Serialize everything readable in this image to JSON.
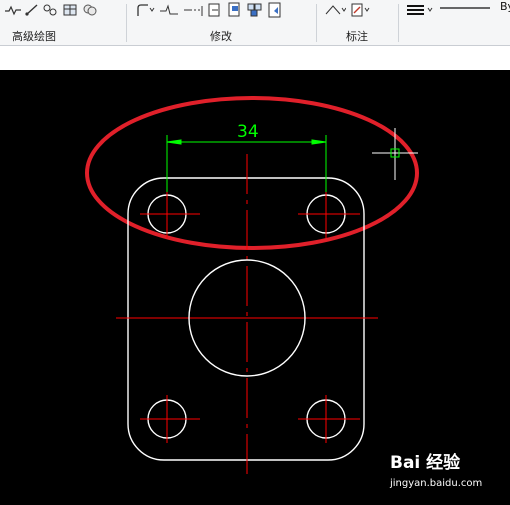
{
  "ribbon": {
    "panels": [
      {
        "label": "高级绘图"
      },
      {
        "label": "修改"
      },
      {
        "label": "标注"
      }
    ],
    "layer_prop_text": "By"
  },
  "drawing": {
    "dimension_text": "34",
    "colors": {
      "geometry": "#ffffff",
      "centerline": "#ff0000",
      "dimension": "#00ff00",
      "highlight": "#e0202a",
      "crosshair": "#ffffff"
    }
  },
  "watermark": {
    "main": "Bai 经验",
    "sub": "jingyan.baidu.com"
  }
}
